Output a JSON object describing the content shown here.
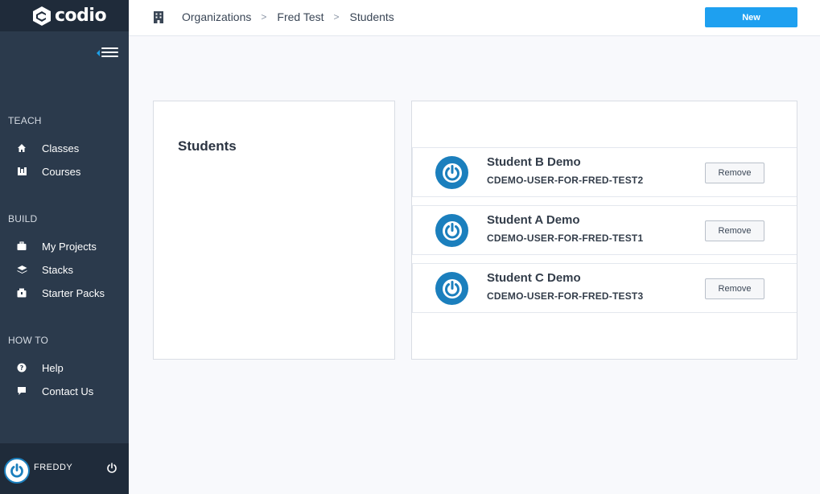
{
  "app": {
    "logo_text": "codio"
  },
  "sidebar": {
    "sections": [
      {
        "heading": "TEACH",
        "items": [
          {
            "label": "Classes",
            "icon": "home-icon"
          },
          {
            "label": "Courses",
            "icon": "courses-icon"
          }
        ]
      },
      {
        "heading": "BUILD",
        "items": [
          {
            "label": "My Projects",
            "icon": "briefcase-icon"
          },
          {
            "label": "Stacks",
            "icon": "stacks-icon"
          },
          {
            "label": "Starter Packs",
            "icon": "package-icon"
          }
        ]
      },
      {
        "heading": "HOW TO",
        "items": [
          {
            "label": "Help",
            "icon": "question-icon"
          },
          {
            "label": "Contact Us",
            "icon": "chat-icon"
          }
        ]
      }
    ],
    "user": {
      "name": "FREDDY"
    }
  },
  "topbar": {
    "breadcrumbs": [
      "Organizations",
      "Fred Test",
      "Students"
    ],
    "new_label": "New"
  },
  "main": {
    "left_panel_title": "Students",
    "students": [
      {
        "name": "Student B Demo",
        "id": "CDEMO-USER-FOR-FRED-TEST2",
        "action": "Remove"
      },
      {
        "name": "Student A Demo",
        "id": "CDEMO-USER-FOR-FRED-TEST1",
        "action": "Remove"
      },
      {
        "name": "Student C Demo",
        "id": "CDEMO-USER-FOR-FRED-TEST3",
        "action": "Remove"
      }
    ]
  },
  "colors": {
    "accent": "#1ea0f0",
    "sidebar": "#2b3a4c",
    "avatar": "#1b7fbd"
  }
}
